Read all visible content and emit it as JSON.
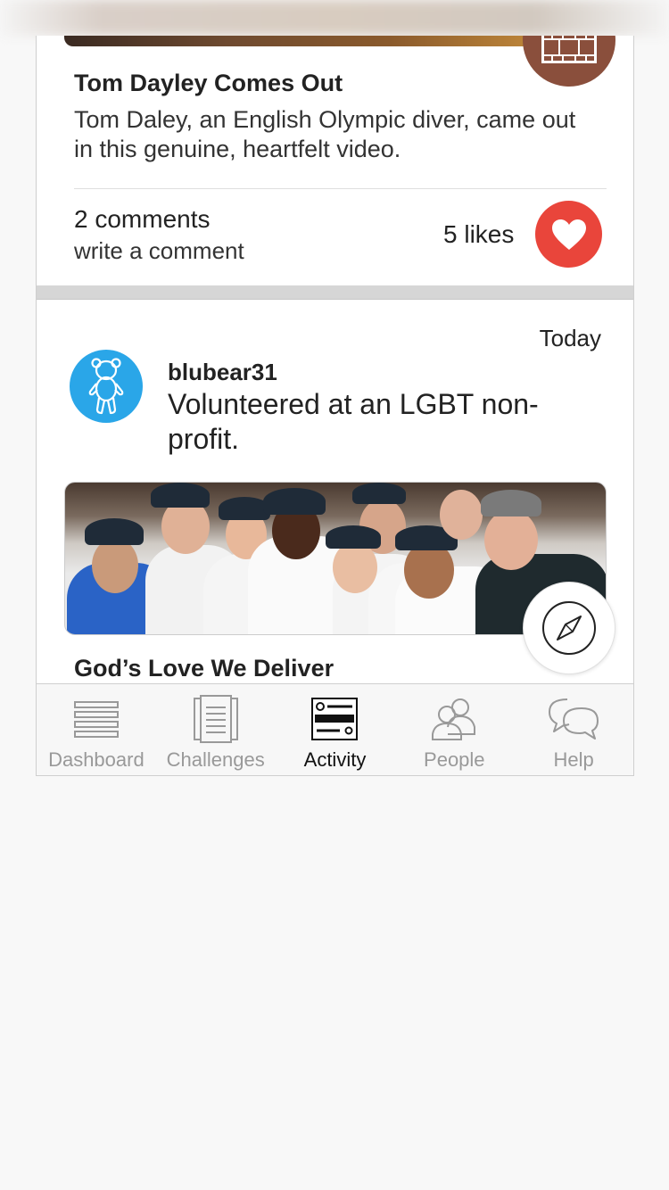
{
  "card1": {
    "title": "Tom Dayley Comes Out",
    "description": "Tom Daley, an English Olympic diver, came out in this genuine, heartfelt video.",
    "comments": "2 comments",
    "write_comment": "write a comment",
    "likes": "5 likes",
    "badge_icon": "film-icon",
    "like_icon": "heart-icon",
    "like_color": "#e9453b"
  },
  "card2": {
    "date": "Today",
    "username": "blubear31",
    "text": "Volunteered at an LGBT non-profit.",
    "title": "God’s Love We Deliver",
    "avatar_icon": "bear-icon",
    "avatar_color": "#2aa6e8",
    "action_icon": "compass-icon"
  },
  "tabs": [
    {
      "label": "Dashboard",
      "icon": "list-icon",
      "active": false
    },
    {
      "label": "Challenges",
      "icon": "document-icon",
      "active": false
    },
    {
      "label": "Activity",
      "icon": "activity-icon",
      "active": true
    },
    {
      "label": "People",
      "icon": "people-icon",
      "active": false
    },
    {
      "label": "Help",
      "icon": "chat-bubbles-icon",
      "active": false
    }
  ]
}
